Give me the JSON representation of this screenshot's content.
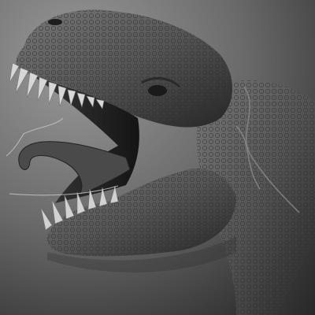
{
  "image": {
    "subject_icon": "trex-head-sculpt-icon",
    "background_top": "#8d8d8d",
    "background_bottom": "#3a3a3a",
    "skin_color": "#5c5c5c",
    "skin_shadow": "#1c1c1c",
    "mouth_color": "#2a2a2a",
    "tooth_color": "#d7d7d7"
  }
}
